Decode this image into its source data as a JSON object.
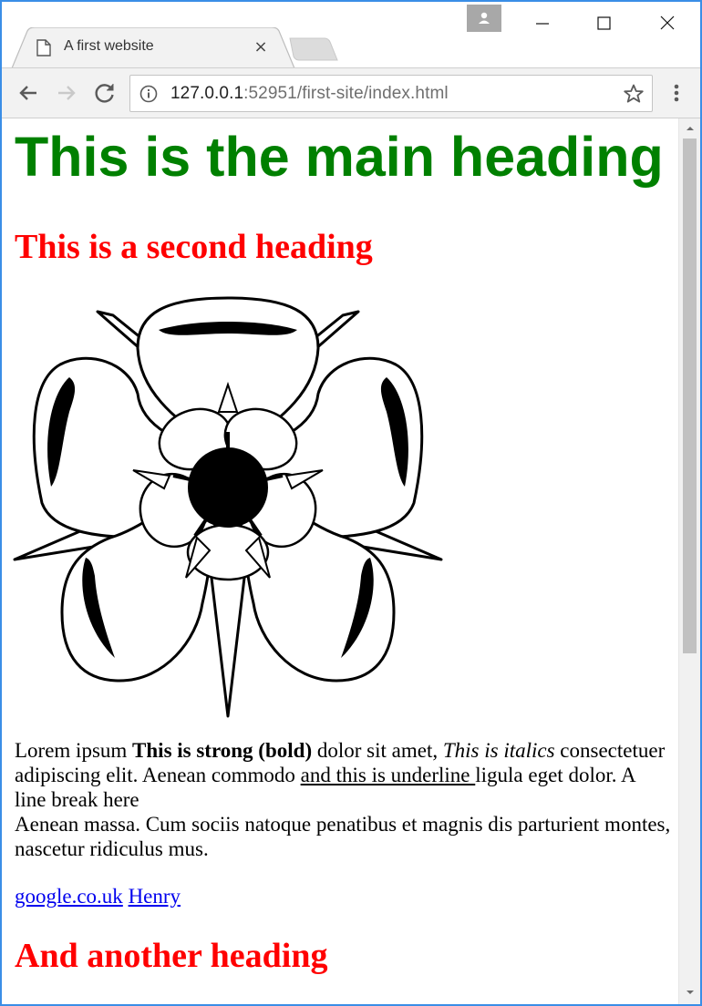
{
  "browser": {
    "tab_title": "A first website",
    "tab_close": "×",
    "url_host": "127.0.0.1",
    "url_rest": ":52951/first-site/index.html"
  },
  "page": {
    "main_heading": "This is the main heading",
    "second_heading": "This is a second heading",
    "paragraph": {
      "t1": "Lorem ipsum ",
      "bold": "This is strong (bold)",
      "t2": " dolor sit amet, ",
      "italic": "This is italics",
      "t3": " consectetuer adipiscing elit. Aenean commodo ",
      "underline": "and this is underline ",
      "t4": "ligula eget dolor. A line break here",
      "t5": "Aenean massa. Cum sociis natoque penatibus et magnis dis parturient montes, nascetur ridiculus mus."
    },
    "links": [
      "google.co.uk",
      "Henry"
    ],
    "another_heading": "And another heading"
  },
  "colors": {
    "main_heading": "#008000",
    "sub_heading": "#ff0000",
    "link": "#0000ee",
    "window_border": "#3a8ee6"
  },
  "icons": [
    "page-icon",
    "close-icon",
    "back-icon",
    "forward-icon",
    "reload-icon",
    "info-icon",
    "star-icon",
    "menu-icon",
    "profile-icon",
    "minimize-icon",
    "maximize-icon",
    "window-close-icon",
    "rose-image"
  ]
}
